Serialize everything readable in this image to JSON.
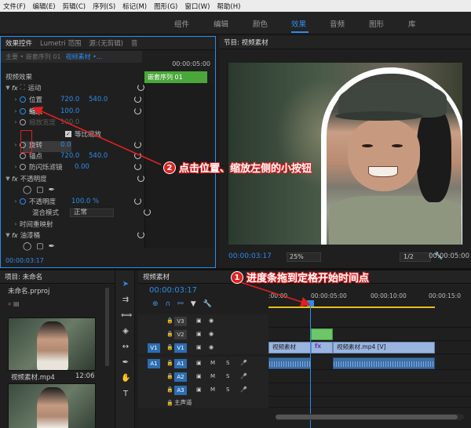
{
  "menu": [
    "文件(F)",
    "编辑(E)",
    "剪辑(C)",
    "序列(S)",
    "标记(M)",
    "图形(G)",
    "窗口(W)",
    "帮助(H)"
  ],
  "workspaces": {
    "tabs": [
      "组件",
      "编辑",
      "颜色",
      "效果",
      "音频",
      "图形",
      "库"
    ],
    "active": "效果"
  },
  "effect_controls": {
    "tabs": [
      "效果控件",
      "Lumetri 范围",
      "源:(无剪辑)",
      "音"
    ],
    "source_label": "主要 • 嵌套序列 01",
    "source_clip": "视频素材 •...",
    "timecode": "00:00:05:00",
    "clip_name": "嵌套序列 01",
    "section": "视频效果",
    "motion": "运动",
    "position_label": "位置",
    "position_x": "720.0",
    "position_y": "540.0",
    "scale_label": "缩放",
    "scale_value": "100.0",
    "scale_width_label": "缩放宽度",
    "scale_width_value": "100.0",
    "uniform_scale": "等比缩放",
    "rotation_label": "旋转",
    "rotation_value": "0.0",
    "anchor_label": "锚点",
    "anchor_x": "720.0",
    "anchor_y": "540.0",
    "flicker_label": "防闪烁滤镜",
    "flicker_value": "0.00",
    "opacity_section": "不透明度",
    "opacity_label": "不透明度",
    "opacity_value": "100.0 %",
    "blend_label": "混合模式",
    "blend_value": "正常",
    "time_remap": "时间重映射",
    "oil_paint": "油漆桶",
    "current_time": "00:00:03:17"
  },
  "program": {
    "title": "节目: 视频素材",
    "timecode": "00:00:03:17",
    "zoom": "25%",
    "resolution": "1/2",
    "duration": "00:00:05:00"
  },
  "project": {
    "title": "项目: 未命名",
    "file": "未命名.prproj",
    "items": [
      {
        "name": "视频素材.mp4",
        "duration": "12:06"
      },
      {
        "name": "",
        "duration": ""
      }
    ]
  },
  "timeline": {
    "title": "视频素材",
    "timecode": "00:00:03:17",
    "ruler": [
      ":00:00",
      "00:00:05:00",
      "00:00:10:00",
      "00:00:15:0"
    ],
    "tracks": [
      {
        "target": "",
        "label": "V3"
      },
      {
        "target": "",
        "label": "V2"
      },
      {
        "target": "V1",
        "label": "V1"
      },
      {
        "target": "A1",
        "label": "A1"
      },
      {
        "target": "",
        "label": "A2"
      },
      {
        "target": "",
        "label": "A3"
      },
      {
        "target": "",
        "label": "主声道"
      }
    ],
    "clips": {
      "v1_a": "视频素材",
      "v1_b": "视频素材.mp4 [V]",
      "nest_marker": "fx"
    }
  },
  "annotations": {
    "step1": {
      "num": "1",
      "text": "进度条拖到定格开始时间点"
    },
    "step2": {
      "num": "2",
      "text": "点击位置、缩放左侧的小按钮"
    }
  },
  "colors": {
    "accent": "#2d8ceb",
    "annotation_red": "#e02020",
    "nest_clip": "#6fc56a",
    "video_clip": "#9ab4e0",
    "audio_clip": "#3d6fa8"
  }
}
